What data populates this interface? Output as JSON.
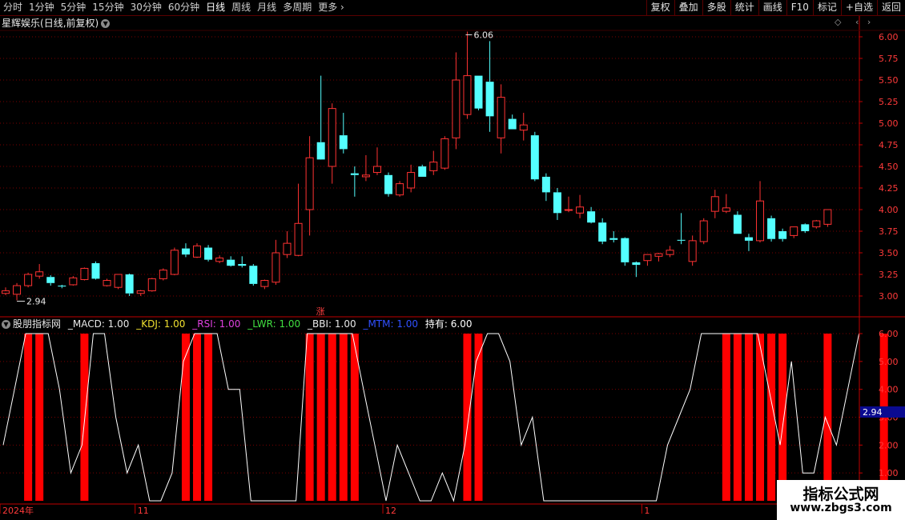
{
  "toolbar": {
    "periods": [
      "分时",
      "1分钟",
      "5分钟",
      "15分钟",
      "30分钟",
      "60分钟",
      "日线",
      "周线",
      "月线",
      "多周期",
      "更多 ›"
    ],
    "active_period": "日线",
    "right": [
      "复权",
      "叠加",
      "多股",
      "统计",
      "画线",
      "F10",
      "标记",
      "+自选",
      "返回"
    ]
  },
  "title": {
    "name": "星辉娱乐",
    "suffix": "(日线,前复权)",
    "dropdown_icon": "chevron-down-icon"
  },
  "top_right_icons": [
    "◇",
    "‹",
    "›"
  ],
  "price_axis": [
    "6.00",
    "5.75",
    "5.50",
    "5.25",
    "5.00",
    "4.75",
    "4.50",
    "4.25",
    "4.00",
    "3.75",
    "3.50",
    "3.25",
    "3.00"
  ],
  "annotations": {
    "high": "6.06",
    "low": "2.94",
    "marker": "涨"
  },
  "indicator": {
    "name": "股朋指标网",
    "items": [
      {
        "label": "_MACD: 1.00",
        "color": "#e8e8e8"
      },
      {
        "label": "_KDJ: 1.00",
        "color": "#f0e030"
      },
      {
        "label": "_RSI: 1.00",
        "color": "#e040e0"
      },
      {
        "label": "_LWR: 1.00",
        "color": "#40e040"
      },
      {
        "label": "_BBI: 1.00",
        "color": "#e8e8e8"
      },
      {
        "label": "_MTM: 1.00",
        "color": "#3050ff"
      },
      {
        "label": "持有: 6.00",
        "color": "#ffffff"
      }
    ],
    "axis": [
      "6.00",
      "5.00",
      "4.00",
      "3.00",
      "2.00",
      "1.00"
    ],
    "current_value": "2.94"
  },
  "date_axis": [
    {
      "label": "2024年",
      "index": 0
    },
    {
      "label": "11",
      "index": 12
    },
    {
      "label": "12",
      "index": 34
    },
    {
      "label": "1",
      "index": 57
    }
  ],
  "logo": {
    "line1": "指标公式网",
    "line2": "www.zbgs3.com"
  },
  "colors": {
    "up": "#ff3232",
    "down": "#54ffff",
    "signal": "#ff0000",
    "line": "#ffffff",
    "grid": "#7a0000"
  },
  "chart_data": {
    "type": "candlestick",
    "price_range": [
      2.94,
      6.06
    ],
    "candles": [
      {
        "o": 3.03,
        "h": 3.1,
        "l": 3.01,
        "c": 3.06
      },
      {
        "o": 3.02,
        "h": 3.15,
        "l": 2.95,
        "c": 3.12
      },
      {
        "o": 3.12,
        "h": 3.27,
        "l": 3.1,
        "c": 3.25
      },
      {
        "o": 3.23,
        "h": 3.37,
        "l": 3.2,
        "c": 3.28
      },
      {
        "o": 3.22,
        "h": 3.24,
        "l": 3.12,
        "c": 3.15
      },
      {
        "o": 3.12,
        "h": 3.13,
        "l": 3.09,
        "c": 3.11
      },
      {
        "o": 3.13,
        "h": 3.23,
        "l": 3.12,
        "c": 3.21
      },
      {
        "o": 3.19,
        "h": 3.33,
        "l": 3.18,
        "c": 3.32
      },
      {
        "o": 3.38,
        "h": 3.4,
        "l": 3.19,
        "c": 3.2
      },
      {
        "o": 3.12,
        "h": 3.2,
        "l": 3.11,
        "c": 3.18
      },
      {
        "o": 3.1,
        "h": 3.25,
        "l": 3.08,
        "c": 3.25
      },
      {
        "o": 3.25,
        "h": 3.26,
        "l": 3.0,
        "c": 3.03
      },
      {
        "o": 3.03,
        "h": 3.07,
        "l": 3.0,
        "c": 3.06
      },
      {
        "o": 3.06,
        "h": 3.21,
        "l": 3.05,
        "c": 3.2
      },
      {
        "o": 3.2,
        "h": 3.32,
        "l": 3.18,
        "c": 3.3
      },
      {
        "o": 3.25,
        "h": 3.56,
        "l": 3.24,
        "c": 3.53
      },
      {
        "o": 3.55,
        "h": 3.61,
        "l": 3.45,
        "c": 3.48
      },
      {
        "o": 3.45,
        "h": 3.61,
        "l": 3.44,
        "c": 3.58
      },
      {
        "o": 3.56,
        "h": 3.59,
        "l": 3.4,
        "c": 3.42
      },
      {
        "o": 3.4,
        "h": 3.47,
        "l": 3.38,
        "c": 3.44
      },
      {
        "o": 3.42,
        "h": 3.46,
        "l": 3.34,
        "c": 3.35
      },
      {
        "o": 3.37,
        "h": 3.46,
        "l": 3.33,
        "c": 3.35
      },
      {
        "o": 3.35,
        "h": 3.37,
        "l": 3.12,
        "c": 3.14
      },
      {
        "o": 3.11,
        "h": 3.19,
        "l": 3.08,
        "c": 3.18
      },
      {
        "o": 3.16,
        "h": 3.65,
        "l": 3.13,
        "c": 3.5
      },
      {
        "o": 3.48,
        "h": 3.75,
        "l": 3.44,
        "c": 3.61
      },
      {
        "o": 3.47,
        "h": 4.3,
        "l": 3.46,
        "c": 3.84
      },
      {
        "o": 4.0,
        "h": 4.85,
        "l": 3.7,
        "c": 4.6
      },
      {
        "o": 4.78,
        "h": 5.55,
        "l": 4.68,
        "c": 4.58
      },
      {
        "o": 4.5,
        "h": 5.23,
        "l": 4.3,
        "c": 5.17
      },
      {
        "o": 4.86,
        "h": 5.12,
        "l": 4.65,
        "c": 4.7
      },
      {
        "o": 4.42,
        "h": 4.5,
        "l": 4.15,
        "c": 4.4
      },
      {
        "o": 4.38,
        "h": 4.63,
        "l": 4.33,
        "c": 4.4
      },
      {
        "o": 4.43,
        "h": 4.72,
        "l": 4.4,
        "c": 4.5
      },
      {
        "o": 4.4,
        "h": 4.43,
        "l": 4.15,
        "c": 4.18
      },
      {
        "o": 4.17,
        "h": 4.33,
        "l": 4.15,
        "c": 4.3
      },
      {
        "o": 4.25,
        "h": 4.52,
        "l": 4.2,
        "c": 4.43
      },
      {
        "o": 4.5,
        "h": 4.52,
        "l": 4.38,
        "c": 4.38
      },
      {
        "o": 4.45,
        "h": 4.68,
        "l": 4.4,
        "c": 4.55
      },
      {
        "o": 4.48,
        "h": 4.85,
        "l": 4.46,
        "c": 4.82
      },
      {
        "o": 4.83,
        "h": 5.82,
        "l": 4.7,
        "c": 5.5
      },
      {
        "o": 5.1,
        "h": 6.06,
        "l": 5.05,
        "c": 5.55
      },
      {
        "o": 5.55,
        "h": 5.55,
        "l": 5.15,
        "c": 5.17
      },
      {
        "o": 5.48,
        "h": 5.95,
        "l": 4.9,
        "c": 5.08
      },
      {
        "o": 4.83,
        "h": 5.45,
        "l": 4.65,
        "c": 5.3
      },
      {
        "o": 5.05,
        "h": 5.1,
        "l": 4.93,
        "c": 4.93
      },
      {
        "o": 4.92,
        "h": 5.12,
        "l": 4.8,
        "c": 4.98
      },
      {
        "o": 4.86,
        "h": 4.9,
        "l": 4.33,
        "c": 4.35
      },
      {
        "o": 4.38,
        "h": 4.42,
        "l": 4.1,
        "c": 4.2
      },
      {
        "o": 4.2,
        "h": 4.25,
        "l": 3.88,
        "c": 3.96
      },
      {
        "o": 4.0,
        "h": 4.15,
        "l": 3.97,
        "c": 4.0
      },
      {
        "o": 3.96,
        "h": 4.17,
        "l": 3.9,
        "c": 4.03
      },
      {
        "o": 3.98,
        "h": 4.03,
        "l": 3.84,
        "c": 3.85
      },
      {
        "o": 3.85,
        "h": 3.9,
        "l": 3.6,
        "c": 3.63
      },
      {
        "o": 3.67,
        "h": 3.75,
        "l": 3.62,
        "c": 3.65
      },
      {
        "o": 3.67,
        "h": 3.68,
        "l": 3.35,
        "c": 3.39
      },
      {
        "o": 3.39,
        "h": 3.4,
        "l": 3.22,
        "c": 3.36
      },
      {
        "o": 3.41,
        "h": 3.48,
        "l": 3.35,
        "c": 3.48
      },
      {
        "o": 3.46,
        "h": 3.5,
        "l": 3.4,
        "c": 3.49
      },
      {
        "o": 3.48,
        "h": 3.58,
        "l": 3.45,
        "c": 3.53
      },
      {
        "o": 3.65,
        "h": 3.96,
        "l": 3.6,
        "c": 3.64
      },
      {
        "o": 3.4,
        "h": 3.7,
        "l": 3.35,
        "c": 3.64
      },
      {
        "o": 3.63,
        "h": 3.9,
        "l": 3.6,
        "c": 3.87
      },
      {
        "o": 3.98,
        "h": 4.23,
        "l": 3.9,
        "c": 4.15
      },
      {
        "o": 3.98,
        "h": 4.18,
        "l": 3.96,
        "c": 4.02
      },
      {
        "o": 3.94,
        "h": 3.98,
        "l": 3.72,
        "c": 3.72
      },
      {
        "o": 3.68,
        "h": 3.72,
        "l": 3.52,
        "c": 3.64
      },
      {
        "o": 3.64,
        "h": 4.33,
        "l": 3.62,
        "c": 4.1
      },
      {
        "o": 3.9,
        "h": 3.93,
        "l": 3.63,
        "c": 3.66
      },
      {
        "o": 3.75,
        "h": 3.78,
        "l": 3.63,
        "c": 3.66
      },
      {
        "o": 3.7,
        "h": 3.8,
        "l": 3.67,
        "c": 3.8
      },
      {
        "o": 3.83,
        "h": 3.84,
        "l": 3.73,
        "c": 3.75
      },
      {
        "o": 3.8,
        "h": 3.88,
        "l": 3.78,
        "c": 3.87
      },
      {
        "o": 3.83,
        "h": 4.0,
        "l": 3.8,
        "c": 4.0
      }
    ],
    "indicator_range": [
      0,
      6
    ],
    "hold_line": [
      2,
      4,
      6,
      6,
      6,
      4,
      1,
      2,
      6,
      6,
      3,
      1,
      2,
      0,
      0,
      1,
      5,
      6,
      6,
      6,
      4,
      4,
      0,
      0,
      0,
      0,
      0,
      6,
      6,
      6,
      6,
      6,
      4,
      2,
      0,
      2,
      1,
      0,
      0,
      1,
      0,
      2,
      5,
      6,
      6,
      5,
      2,
      3,
      0,
      0,
      0,
      0,
      0,
      0,
      0,
      0,
      0,
      0,
      0,
      2,
      3,
      4,
      6,
      6,
      6,
      6,
      6,
      6,
      4,
      2,
      5,
      1,
      1,
      3,
      2,
      4,
      6
    ],
    "signal_bars": [
      2,
      3,
      7,
      16,
      17,
      18,
      27,
      28,
      29,
      30,
      31,
      41,
      42,
      64,
      65,
      66,
      67,
      68,
      69,
      73,
      78
    ]
  }
}
